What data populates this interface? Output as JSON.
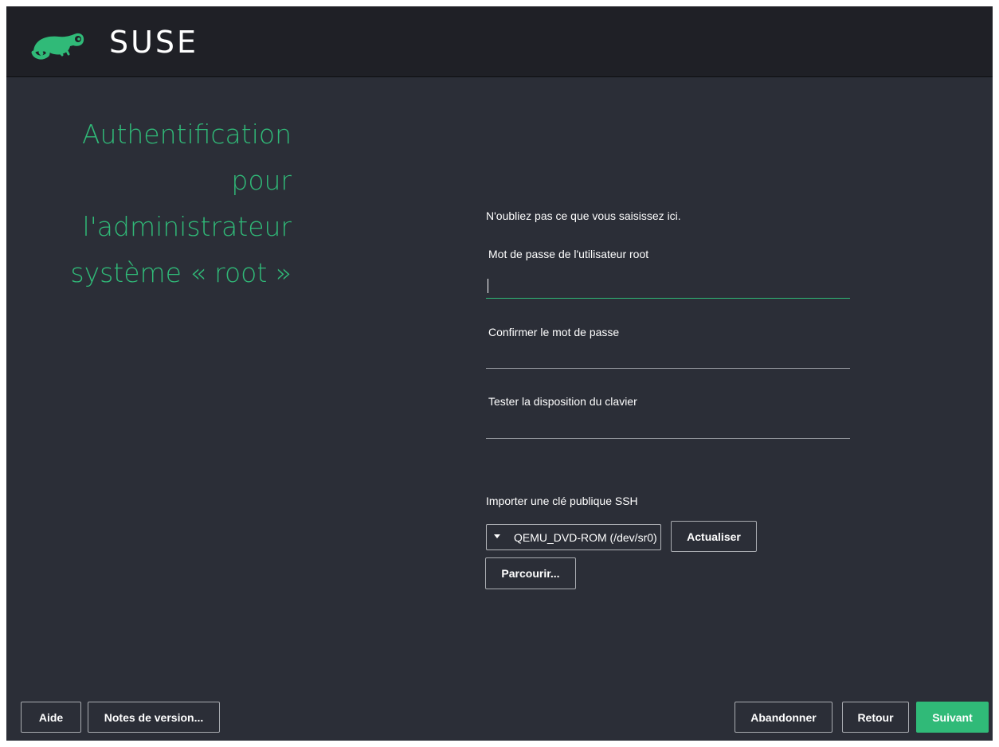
{
  "brand": {
    "logo_text": "SUSE",
    "accent_color": "#30ba78"
  },
  "page": {
    "title_lines": [
      "Authentification",
      "pour",
      "l'administrateur",
      "système « root »"
    ]
  },
  "form": {
    "note": "N'oubliez pas ce que vous saisissez ici.",
    "password_label": "Mot de passe de l'utilisateur root",
    "password_value": "",
    "confirm_label": "Confirmer le mot de passe",
    "confirm_value": "",
    "keyboard_test_label": "Tester la disposition du clavier",
    "keyboard_test_value": ""
  },
  "ssh": {
    "label": "Importer une clé publique SSH",
    "device_selected": "QEMU_DVD-ROM (/dev/sr0)",
    "refresh_label": "Actualiser",
    "browse_label": "Parcourir..."
  },
  "footer": {
    "help_label": "Aide",
    "release_notes_label": "Notes de version...",
    "abort_label": "Abandonner",
    "back_label": "Retour",
    "next_label": "Suivant"
  }
}
